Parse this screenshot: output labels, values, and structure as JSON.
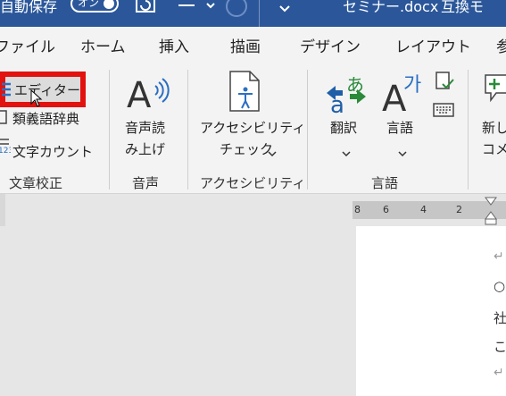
{
  "titlebar": {
    "autosave_label": "自動保存",
    "autosave_state": "オン",
    "doc_name": "セミナー.docx",
    "mode": "互換モ"
  },
  "tabs": [
    "ファイル",
    "ホーム",
    "挿入",
    "描画",
    "デザイン",
    "レイアウト",
    "参"
  ],
  "ribbon": {
    "proofing": {
      "editor": "エディター",
      "thesaurus": "類義語辞典",
      "word_count": "文字カウント",
      "group": "文章校正"
    },
    "voice": {
      "read_aloud_1": "音声読",
      "read_aloud_2": "み上げ",
      "group": "音声"
    },
    "accessibility": {
      "check_1": "アクセシビリティ",
      "check_2": "チェック",
      "group": "アクセシビリティ"
    },
    "language": {
      "translate": "翻訳",
      "language": "言語",
      "group": "言語"
    },
    "comments": {
      "new_1": "新し",
      "new_2": "コメ"
    }
  },
  "ruler": [
    "8",
    "6",
    "4",
    "2"
  ],
  "document": {
    "line1": "○",
    "line2": "社",
    "line3": "こ",
    "para_mark": "↵"
  },
  "colors": {
    "title_bg": "#2b579a",
    "ribbon_bg": "#f3f3f3",
    "highlight": "#e2120f"
  }
}
